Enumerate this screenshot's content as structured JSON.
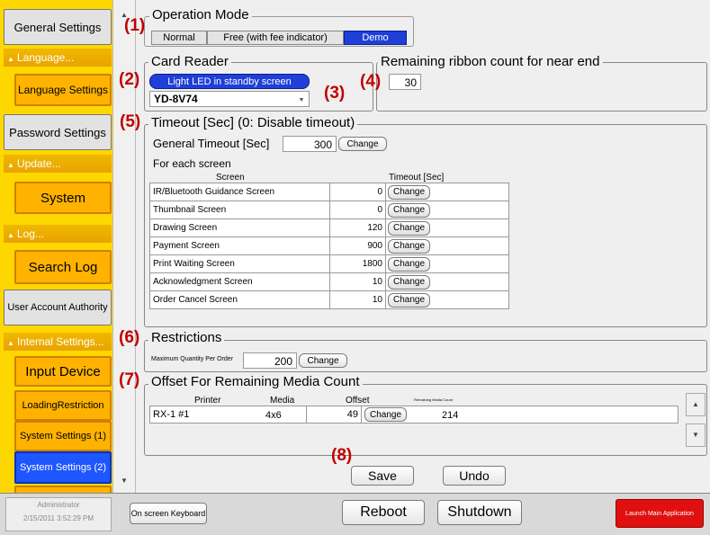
{
  "sidebar": {
    "general_settings": "General Settings",
    "language_cat": "Language...",
    "language_settings": "Language Settings",
    "password_settings": "Password Settings",
    "update_cat": "Update...",
    "system": "System",
    "log_cat": "Log...",
    "search_log": "Search Log",
    "user_account_authority": "User Account Authority",
    "internal_cat": "Internal Settings...",
    "input_device": "Input Device",
    "loading_restriction": "LoadingRestriction",
    "system_settings_1": "System Settings (1)",
    "system_settings_2": "System Settings (2)"
  },
  "markers": [
    "(1)",
    "(2)",
    "(3)",
    "(4)",
    "(5)",
    "(6)",
    "(7)",
    "(8)"
  ],
  "operation_mode": {
    "title": "Operation Mode",
    "options": [
      "Normal",
      "Free (with fee indicator)",
      "Demo"
    ],
    "selected": "Demo"
  },
  "card_reader": {
    "title": "Card Reader",
    "led_button": "Light LED in standby screen",
    "model": "YD-8V74"
  },
  "ribbon": {
    "title": "Remaining ribbon count for near end",
    "value": "30"
  },
  "timeout": {
    "title": "Timeout [Sec] (0: Disable timeout)",
    "general_label": "General Timeout [Sec]",
    "general_value": "300",
    "change": "Change",
    "for_each": "For each screen",
    "col_screen": "Screen",
    "col_timeout": "Timeout [Sec]",
    "rows": [
      {
        "screen": "IR/Bluetooth Guidance Screen",
        "value": "0"
      },
      {
        "screen": "Thumbnail Screen",
        "value": "0"
      },
      {
        "screen": "Drawing Screen",
        "value": "120"
      },
      {
        "screen": "Payment Screen",
        "value": "900"
      },
      {
        "screen": "Print Waiting Screen",
        "value": "1800"
      },
      {
        "screen": "Acknowledgment Screen",
        "value": "10"
      },
      {
        "screen": "Order Cancel Screen",
        "value": "10"
      }
    ]
  },
  "restrictions": {
    "title": "Restrictions",
    "max_label": "Maximum Quantity Per Order",
    "max_value": "200",
    "change": "Change"
  },
  "offset": {
    "title": "Offset For Remaining Media Count",
    "col_printer": "Printer",
    "col_media": "Media",
    "col_offset": "Offset",
    "col_remaining": "Remaining Media Count",
    "printer": "RX-1 #1",
    "media": "4x6",
    "offset": "49",
    "remaining": "214",
    "change": "Change"
  },
  "actions": {
    "save": "Save",
    "undo": "Undo"
  },
  "bottom": {
    "user": "Administrator",
    "datetime": "2/15/2011 3:52:29 PM",
    "keyboard": "On screen Keyboard",
    "reboot": "Reboot",
    "shutdown": "Shutdown",
    "launch": "Launch Main Application"
  }
}
